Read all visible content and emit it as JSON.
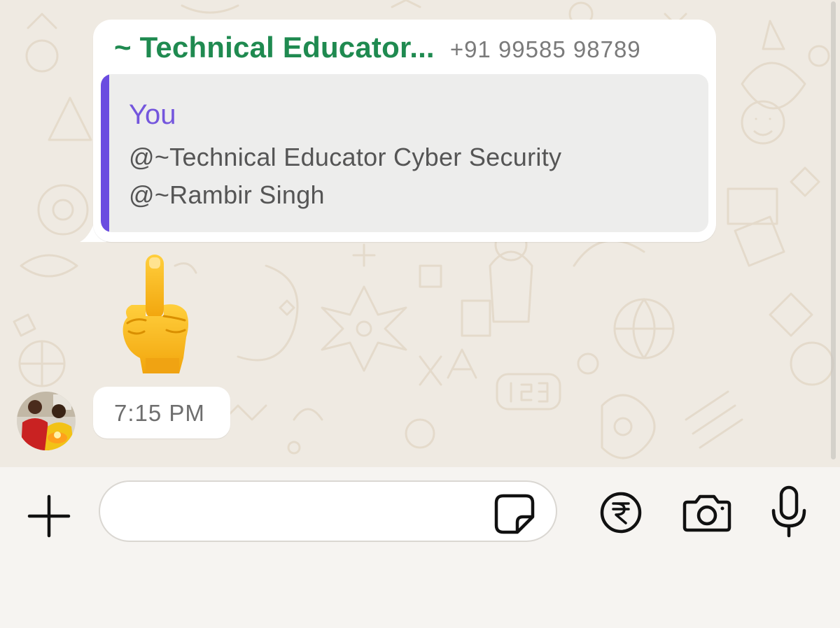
{
  "message": {
    "sender_name": "~ Technical Educator...",
    "sender_phone": "+91 99585 98789",
    "quote": {
      "author": "You",
      "lines": [
        "@~Technical Educator Cyber Security",
        "@~Rambir Singh"
      ]
    },
    "emoji": "middle-finger-emoji",
    "time": "7:15 PM"
  },
  "composer": {
    "placeholder": "",
    "value": "",
    "icons": [
      "plus-icon",
      "sticker-icon",
      "rupee-payment-icon",
      "camera-icon",
      "microphone-icon"
    ]
  },
  "colors": {
    "sender_name": "#1f8a50",
    "quote_author": "#7456dd",
    "quote_bar": "#6a4ce0",
    "chat_background": "#efeae2"
  }
}
